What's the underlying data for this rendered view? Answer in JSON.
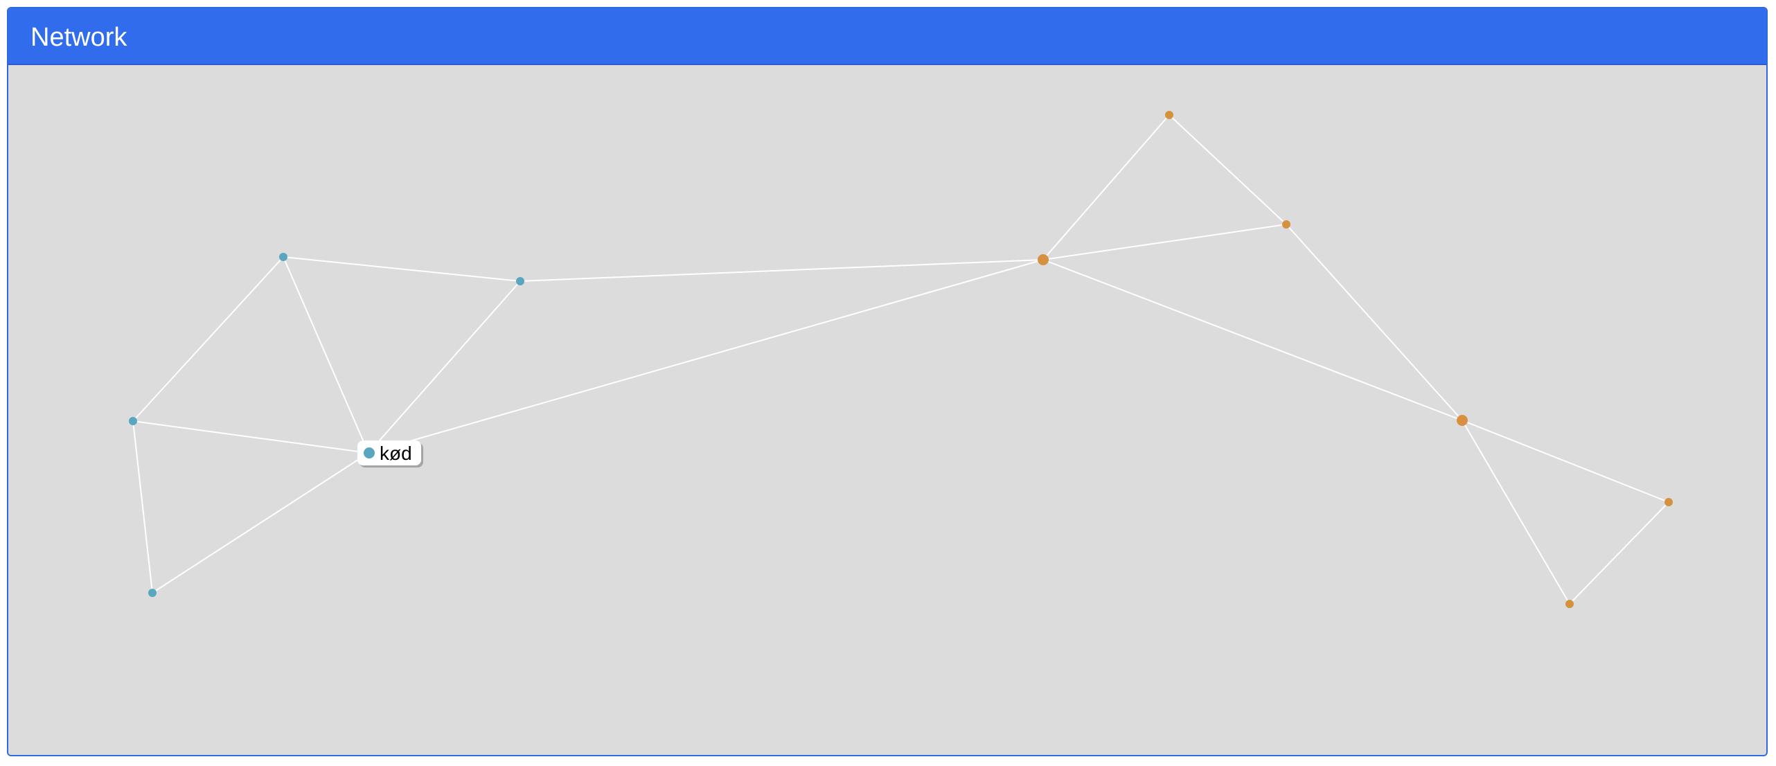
{
  "panel": {
    "title": "Network"
  },
  "network": {
    "nodes": [
      {
        "id": "n1",
        "group": "blue"
      },
      {
        "id": "n2",
        "group": "blue"
      },
      {
        "id": "n3",
        "group": "blue"
      },
      {
        "id": "n4",
        "group": "blue",
        "label": "kød"
      },
      {
        "id": "n5",
        "group": "blue"
      },
      {
        "id": "o1",
        "group": "orange"
      },
      {
        "id": "o2",
        "group": "orange"
      },
      {
        "id": "o3",
        "group": "orange"
      },
      {
        "id": "o4",
        "group": "orange"
      },
      {
        "id": "o5",
        "group": "orange"
      },
      {
        "id": "o6",
        "group": "orange"
      }
    ],
    "edges": [
      [
        "n1",
        "n2"
      ],
      [
        "n1",
        "n3"
      ],
      [
        "n1",
        "n4"
      ],
      [
        "n2",
        "o3"
      ],
      [
        "n2",
        "n4"
      ],
      [
        "n3",
        "n4"
      ],
      [
        "n3",
        "n5"
      ],
      [
        "n4",
        "n5"
      ],
      [
        "n4",
        "o3"
      ],
      [
        "o1",
        "o2"
      ],
      [
        "o1",
        "o3"
      ],
      [
        "o2",
        "o3"
      ],
      [
        "o2",
        "o4"
      ],
      [
        "o3",
        "o4"
      ],
      [
        "o4",
        "o5"
      ],
      [
        "o4",
        "o6"
      ],
      [
        "o5",
        "o6"
      ]
    ],
    "hovered_node": "n4",
    "colors": {
      "blue": "#5aa6c0",
      "orange": "#d6913f",
      "edge": "#ffffff",
      "background": "#dcdcdc",
      "header": "#316cec"
    }
  }
}
